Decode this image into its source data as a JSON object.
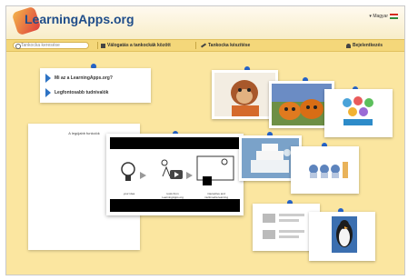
{
  "header": {
    "logo_text": "LearningApps.org",
    "language": "▾ Magyar",
    "colors": {
      "title": "#1f4d8a",
      "navbar": "#f4d77a",
      "background": "#fbe6a0",
      "pin": "#2563c9"
    }
  },
  "navbar": {
    "search_placeholder": "Tankocka keresése",
    "browse_label": "Válogatás a tankockák között",
    "create_label": "Tankocka készítése",
    "login_label": "Bejelentkezés"
  },
  "info": {
    "items": [
      {
        "label": "Mi az a LearningApps.org?"
      },
      {
        "label": "Legfontosabb tudnivalók"
      }
    ]
  },
  "favorites": {
    "title": "A legújabb funkciók"
  },
  "video": {
    "captions": [
      "your idea",
      "tools from LearningApps.org",
      "interactive and multimedia learning"
    ]
  },
  "gallery": {
    "icons": [
      "monkey-image-icon",
      "pumpkin-image-icon",
      "matematika-app-icon",
      "cake-image-icon",
      "cupcakes-image-icon",
      "worksheet-image-icon",
      "penguin-image-icon"
    ]
  }
}
